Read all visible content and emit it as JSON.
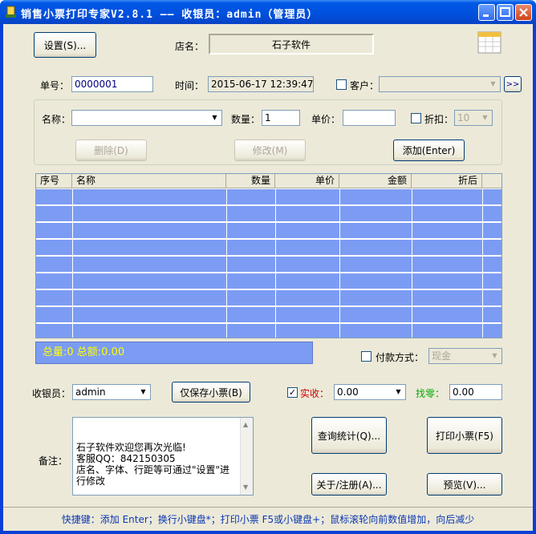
{
  "window": {
    "title": "销售小票打印专家V2.8.1 —— 收银员：admin（管理员）"
  },
  "top": {
    "settings_btn": "设置(S)...",
    "store_label": "店名：",
    "store_name": "石子软件",
    "calendar_icon": "calendar-icon"
  },
  "order": {
    "no_label": "单号：",
    "no_value": "0000001",
    "time_label": "时间：",
    "time_value": "2015-06-17 12:39:47",
    "customer_label": "客户：",
    "customer_value": "",
    "more_btn": ">>"
  },
  "item": {
    "name_label": "名称：",
    "name_value": "",
    "qty_label": "数量：",
    "qty_value": "1",
    "price_label": "单价：",
    "price_value": "",
    "discount_label": "折扣：",
    "discount_value": "10",
    "delete_btn": "删除(D)",
    "modify_btn": "修改(M)",
    "add_btn": "添加(Enter)"
  },
  "table": {
    "columns": [
      "序号",
      "名称",
      "数量",
      "单价",
      "金额",
      "折后"
    ],
    "rows": 9
  },
  "totals": {
    "text": "总量:0  总额:0.00"
  },
  "payment": {
    "label": "付款方式：",
    "value": "现金"
  },
  "cashier": {
    "label": "收银员：",
    "value": "admin",
    "save_only_btn": "仅保存小票(B)",
    "received_label": "实收：",
    "received_value": "0.00",
    "change_label": "找零：",
    "change_value": "0.00"
  },
  "remark": {
    "label": "备注：",
    "text": "石子软件欢迎您再次光临!\n客服QQ：842150305\n店名、字体、行距等可通过\"设置\"进行修改"
  },
  "actions": {
    "stats_btn": "查询统计(Q)...",
    "print_btn": "打印小票(F5)",
    "about_btn": "关于/注册(A)...",
    "preview_btn": "预览(V)..."
  },
  "status": {
    "text": "快捷键：添加 Enter；换行小键盘*；打印小票 F5或小键盘+；鼠标滚轮向前数值增加，向后减少"
  },
  "colors": {
    "title_bar": "#0054e3",
    "grid_row": "#7c9cf4",
    "totals_text": "#ffff00",
    "received_label": "#cc0000",
    "change_label": "#00aa00",
    "status_text": "#0a37b3"
  }
}
